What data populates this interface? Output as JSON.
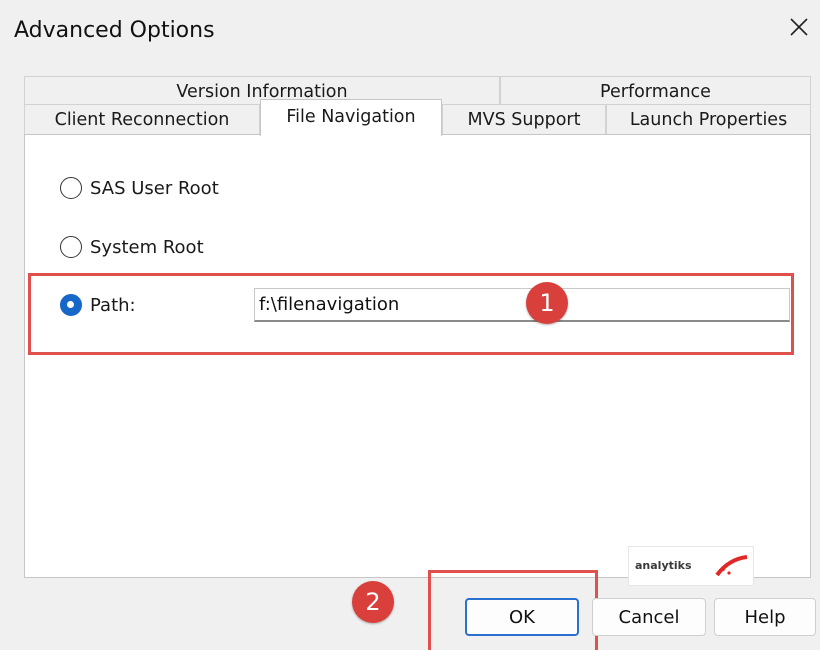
{
  "dialog": {
    "title": "Advanced Options",
    "close_icon": "close-icon"
  },
  "tabs": {
    "row1": [
      {
        "label": "Version Information"
      },
      {
        "label": "Performance"
      }
    ],
    "row2": [
      {
        "label": "Client Reconnection"
      },
      {
        "label": "File Navigation",
        "active": true
      },
      {
        "label": "MVS Support"
      },
      {
        "label": "Launch Properties"
      }
    ]
  },
  "file_navigation": {
    "options": [
      {
        "label": "SAS User Root",
        "checked": false
      },
      {
        "label": "System Root",
        "checked": false
      },
      {
        "label": "Path:",
        "checked": true
      }
    ],
    "path_value": "f:\\filenavigation"
  },
  "annotations": {
    "badge1": "1",
    "badge2": "2",
    "highlight_color": "#e0504c",
    "badge_color": "#d9403c"
  },
  "logo": {
    "text": "analytiks"
  },
  "buttons": {
    "ok": "OK",
    "cancel": "Cancel",
    "help": "Help"
  },
  "colors": {
    "accent": "#1667c7",
    "default_button_border": "#2b6fd0"
  }
}
